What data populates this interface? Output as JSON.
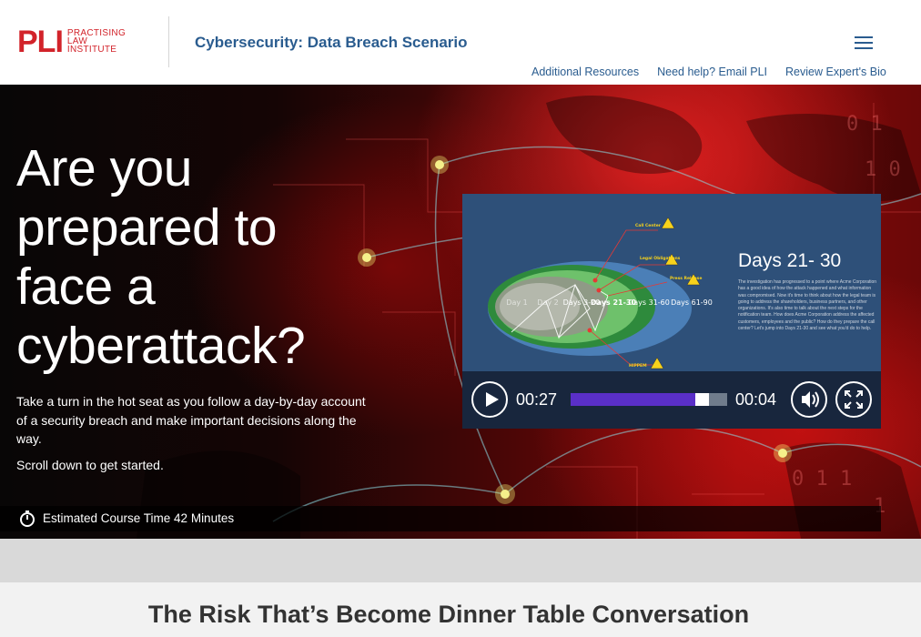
{
  "header": {
    "logo_mark": "PLI",
    "logo_lines": [
      "PRACTISING",
      "LAW",
      "INSTITUTE"
    ],
    "course_title": "Cybersecurity: Data Breach Scenario",
    "menu_icon": "hamburger-menu-icon",
    "links": [
      "Additional Resources",
      "Need help? Email PLI",
      "Review Expert's Bio"
    ]
  },
  "hero": {
    "headline": "Are you prepared to face a cyberattack?",
    "intro": "Take a turn in the hot seat as you follow a day-by-day account of a security breach and make important decisions along the way.",
    "scroll_note": "Scroll down to get started.",
    "course_time": "Estimated Course Time 42 Minutes",
    "timer_icon": "stopwatch-icon"
  },
  "video": {
    "slide": {
      "title": "Days 21- 30",
      "paragraph": "The investigation has progressed to a point where Acme Corporation has a good idea of how the attack happened and what information was compromised. Now it's time to think about how the legal team is going to address the shareholders, business partners, and other organizations. It's also time to talk about the next steps for the notification team. How does Acme Corporation address the affected customers, employees and the public? How do they prepare the call center? Let's jump into Days 21-30 and see what you'd do to help.",
      "phases": [
        "Day 1",
        "Day 2",
        "Days 3-20",
        "Days 21-30",
        "Days 31-60",
        "Days 61-90"
      ],
      "markers": [
        "Call Center",
        "Legal Obligations",
        "Press Release",
        "HIPPEM"
      ],
      "warning_icon": "warning-triangle-icon"
    },
    "controls": {
      "time_current": "00:27",
      "time_remaining": "00:04",
      "progress": 0.87,
      "play_icon": "play-icon",
      "volume_icon": "volume-icon",
      "fullscreen_icon": "fullscreen-icon"
    }
  },
  "section": {
    "title": "The Risk That’s Become Dinner Table Conversation"
  },
  "colors": {
    "brand_red": "#d2232a",
    "link_blue": "#2a5c8f",
    "progress_purple": "#5a2fc8"
  }
}
